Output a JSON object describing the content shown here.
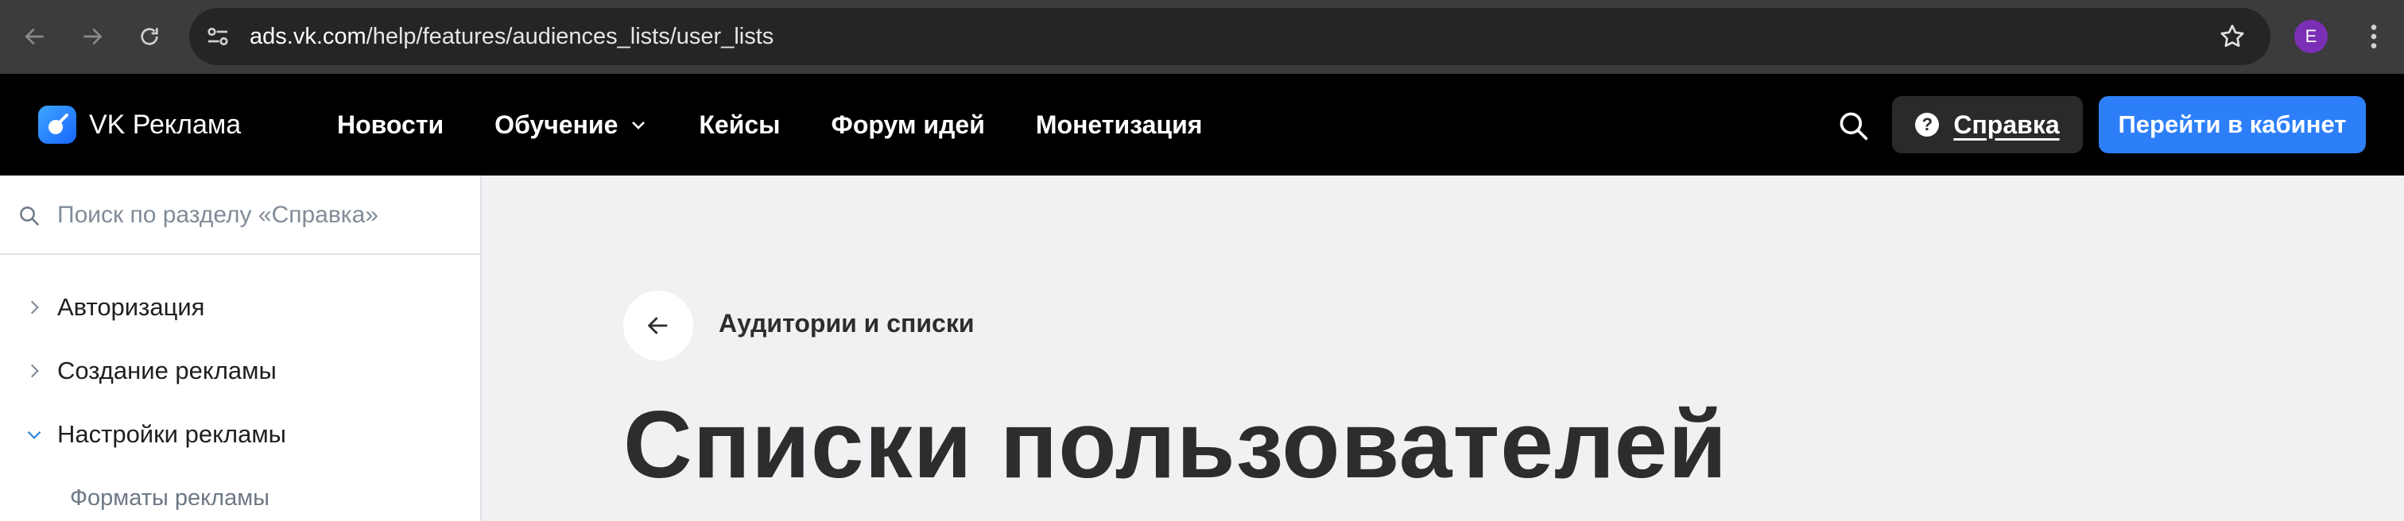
{
  "browser": {
    "url_host": "ads.vk.com",
    "url_path": "/help/features/audiences_lists/user_lists",
    "profile_initial": "E",
    "profile_color": "#7b2fb6"
  },
  "header": {
    "logo_text": "VK Реклама",
    "nav": [
      {
        "label": "Новости",
        "has_dropdown": false
      },
      {
        "label": "Обучение",
        "has_dropdown": true
      },
      {
        "label": "Кейсы",
        "has_dropdown": false
      },
      {
        "label": "Форум идей",
        "has_dropdown": false
      },
      {
        "label": "Монетизация",
        "has_dropdown": false
      }
    ],
    "help_label": "Справка",
    "cabinet_label": "Перейти в кабинет",
    "accent_color": "#2d7ff9"
  },
  "sidebar": {
    "search_placeholder": "Поиск по разделу «Справка»",
    "items": [
      {
        "label": "Авторизация",
        "expanded": false
      },
      {
        "label": "Создание рекламы",
        "expanded": false
      },
      {
        "label": "Настройки рекламы",
        "expanded": true
      }
    ],
    "sub_items": [
      {
        "label": "Форматы рекламы"
      }
    ]
  },
  "content": {
    "breadcrumb": "Аудитории и списки",
    "title": "Списки пользователей"
  }
}
